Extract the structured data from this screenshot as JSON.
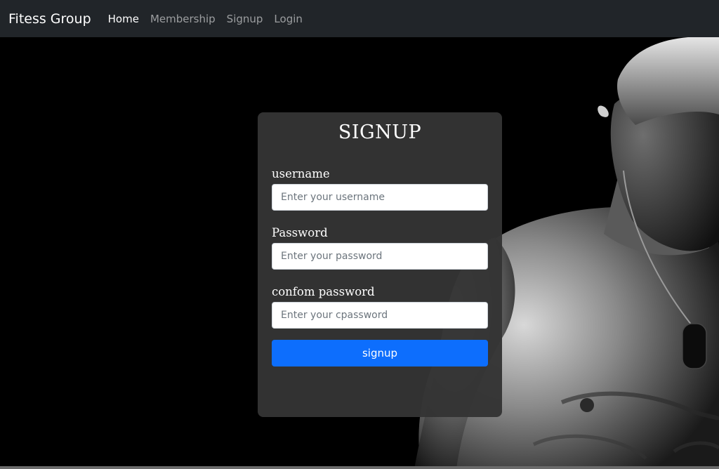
{
  "navbar": {
    "brand": "Fitess Group",
    "links": [
      {
        "label": "Home",
        "active": true
      },
      {
        "label": "Membership",
        "active": false
      },
      {
        "label": "Signup",
        "active": false
      },
      {
        "label": "Login",
        "active": false
      }
    ]
  },
  "form": {
    "title": "SIGNUP",
    "fields": [
      {
        "label": "username",
        "placeholder": "Enter your username",
        "value": ""
      },
      {
        "label": "Password",
        "placeholder": "Enter your password",
        "value": ""
      },
      {
        "label": "confom password",
        "placeholder": "Enter your cpassword",
        "value": ""
      }
    ],
    "submit_label": "signup"
  },
  "colors": {
    "navbar_bg": "#212529",
    "card_bg": "#343434",
    "button_bg": "#0d6efd"
  }
}
